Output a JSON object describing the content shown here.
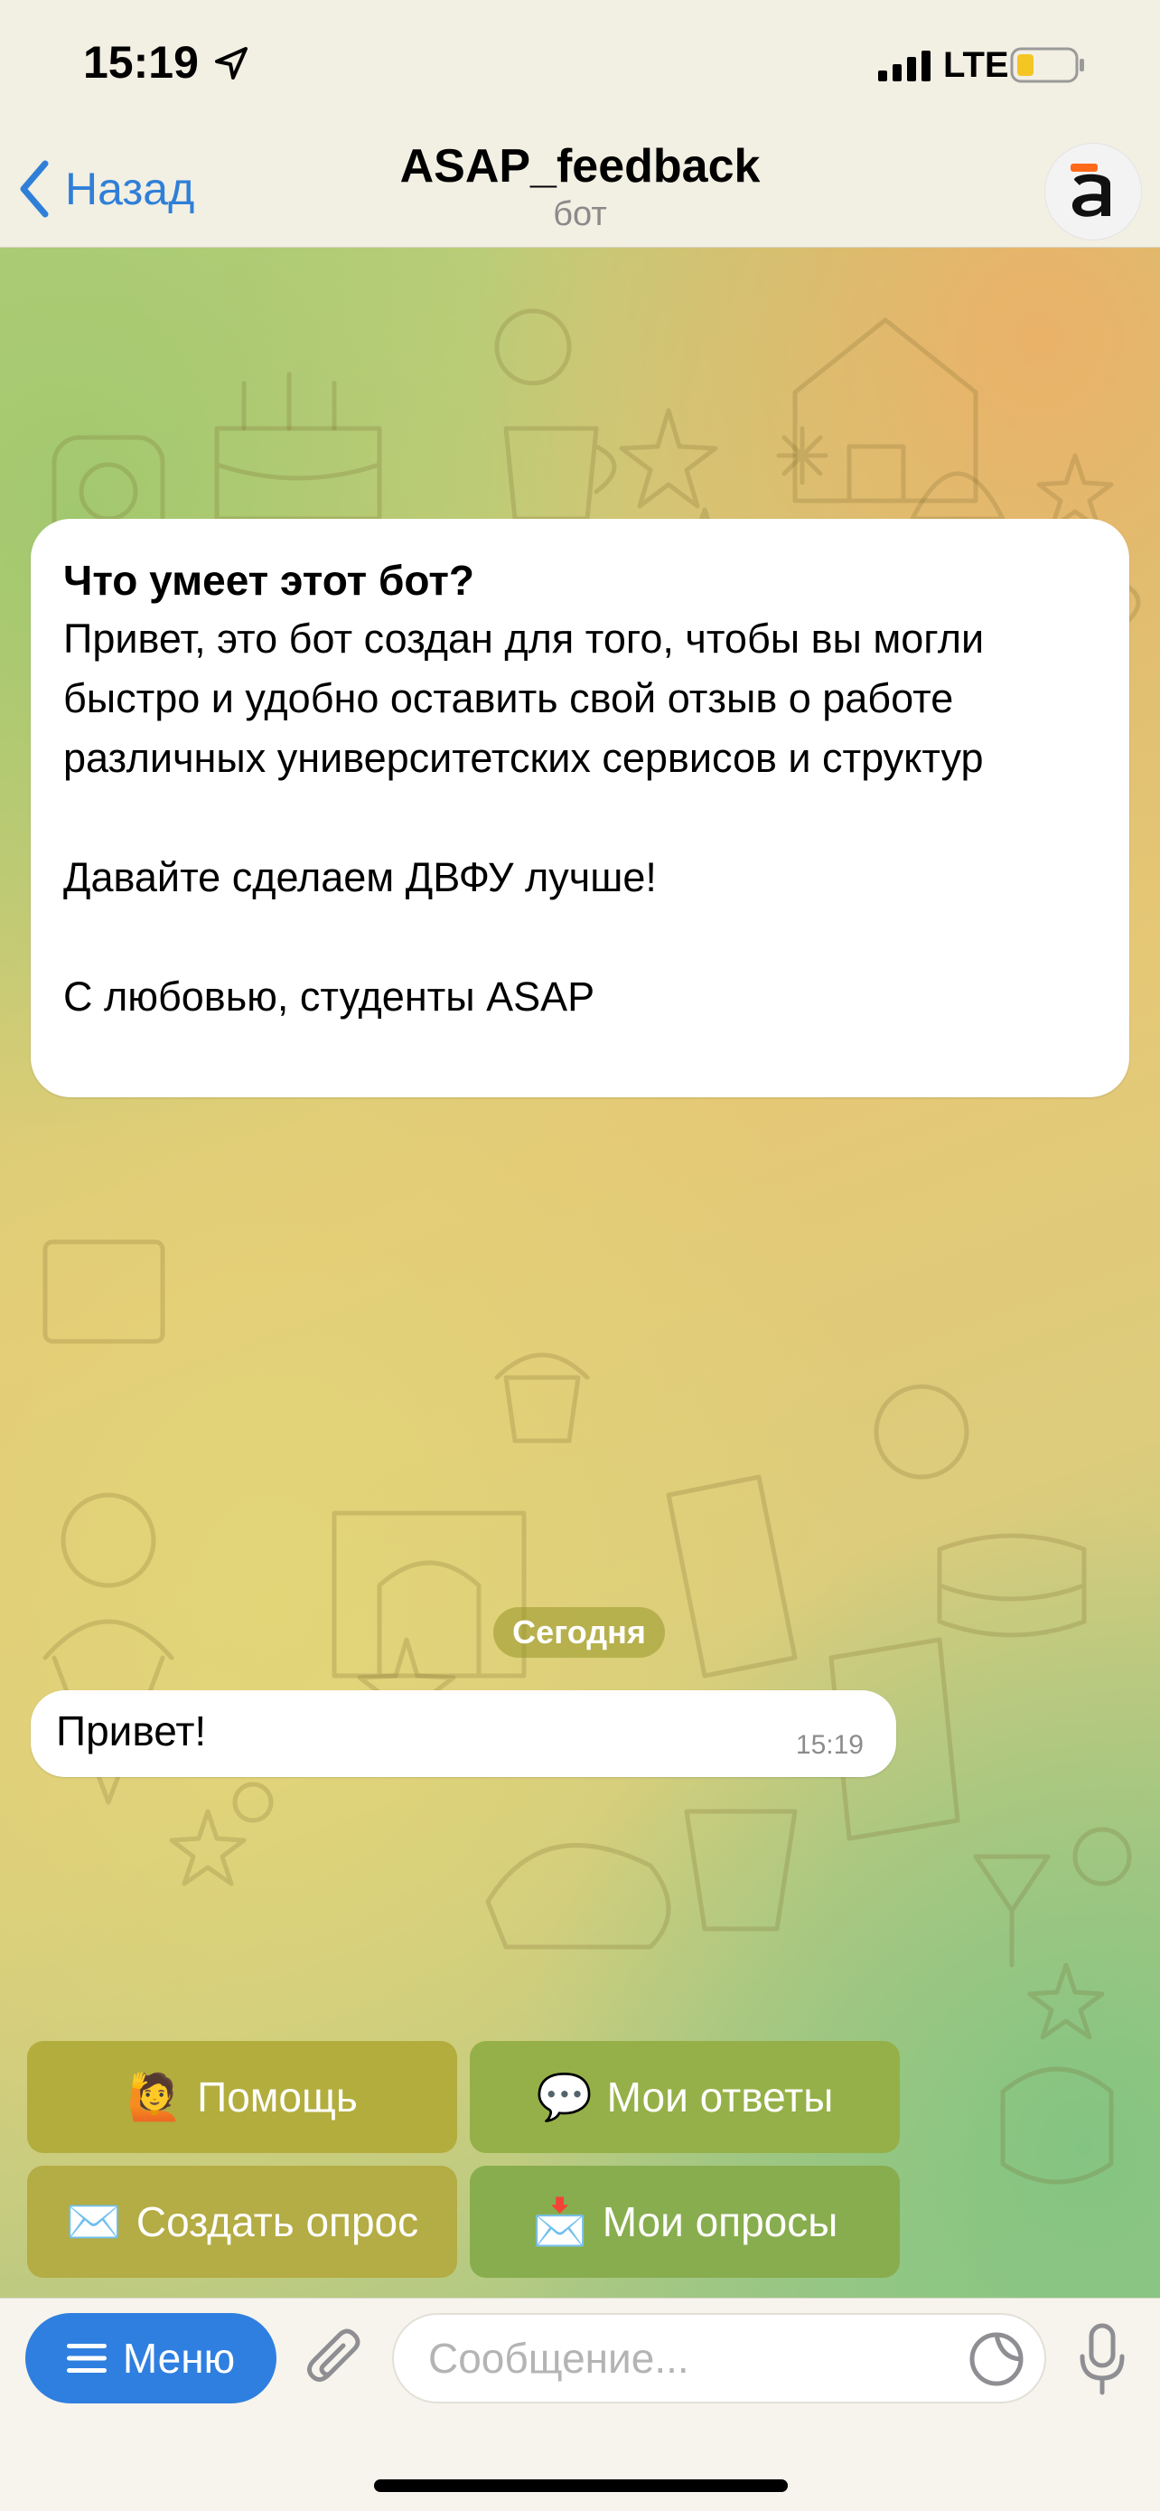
{
  "status_bar": {
    "time": "15:19",
    "network": "LTE",
    "icons": [
      "location-arrow-icon",
      "signal-bars-icon",
      "battery-low-icon"
    ]
  },
  "nav": {
    "back_label": "Назад",
    "title": "ASAP_feedback",
    "subtitle": "бот",
    "avatar_letter": "a"
  },
  "info_card": {
    "title": "Что умеет этот бот?",
    "text": "Привет, это бот создан для того, чтобы вы могли быстро и удобно оставить свой отзыв о работе различных университетских сервисов и структур\n\nДавайте сделаем ДВФУ лучше!\n\nС любовью, студенты ASAP"
  },
  "date_separator": "Сегодня",
  "message": {
    "text": "Привет!",
    "time": "15:19"
  },
  "keyboard": {
    "buttons": [
      {
        "emoji": "🙋",
        "label": "Помощь"
      },
      {
        "emoji": "💬",
        "label": "Мои ответы"
      },
      {
        "emoji": "✉️",
        "label": "Создать опрос"
      },
      {
        "emoji": "📩",
        "label": "Мои опросы"
      }
    ]
  },
  "input_bar": {
    "menu_label": "Меню",
    "placeholder": "Сообщение...",
    "value": ""
  },
  "colors": {
    "accent": "#2f7fe0",
    "link": "#2f7fd8",
    "keyboard_button": "#b3ad3e"
  }
}
